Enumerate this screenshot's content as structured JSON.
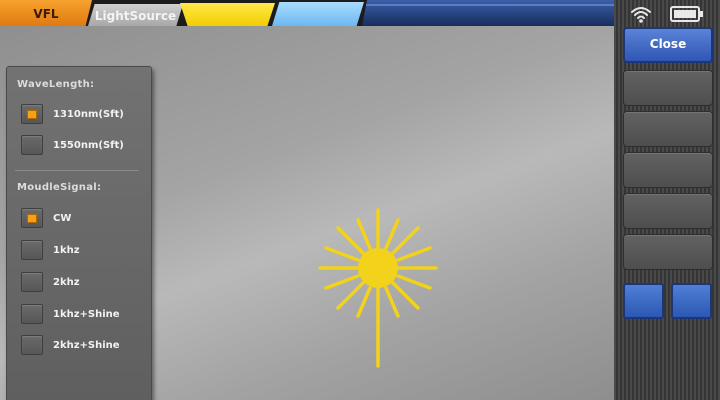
{
  "tabs": [
    {
      "label": "VFL",
      "active": true
    },
    {
      "label": "LightSource",
      "active": false
    }
  ],
  "panel": {
    "wavelength_heading": "WaveLength:",
    "wavelength_options": [
      {
        "label": "1310nm(Sft)",
        "checked": true
      },
      {
        "label": "1550nm(Sft)",
        "checked": false
      }
    ],
    "signal_heading": "MoudleSignal:",
    "signal_options": [
      {
        "label": "CW",
        "checked": true
      },
      {
        "label": "1khz",
        "checked": false
      },
      {
        "label": "2khz",
        "checked": false
      },
      {
        "label": "1khz+Shine",
        "checked": false
      },
      {
        "label": "2khz+Shine",
        "checked": false
      }
    ]
  },
  "sidebar": {
    "close_label": "Close",
    "status_icons": [
      "wifi-icon",
      "battery-icon"
    ]
  },
  "colors": {
    "accent_orange": "#f5a21a",
    "laser_yellow": "#f2d21a",
    "button_blue": "#3c66c4"
  }
}
